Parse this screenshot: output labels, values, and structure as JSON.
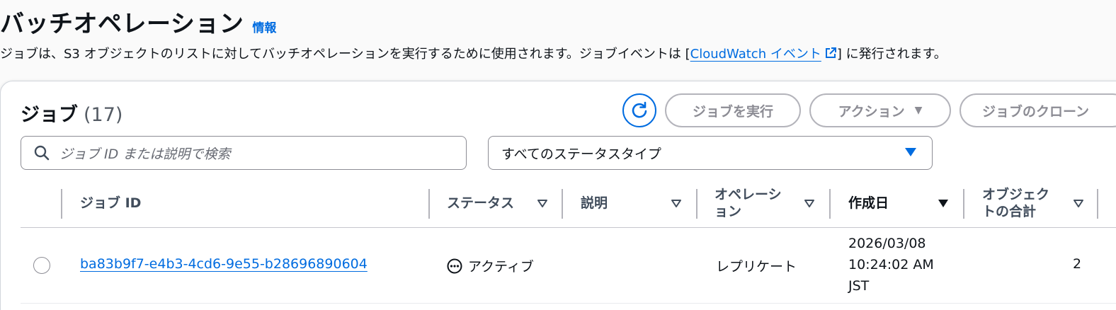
{
  "header": {
    "title": "バッチオペレーション",
    "info": "情報",
    "desc_before": "ジョブは、S3 オブジェクトのリストに対してバッチオペレーションを実行するために使用されます。ジョブイベントは [",
    "desc_link": "CloudWatch イベント",
    "desc_after": "] に発行されます。"
  },
  "jobs": {
    "title": "ジョブ",
    "count": "(17)",
    "run_label": "ジョブを実行",
    "actions_label": "アクション",
    "clone_label": "ジョブのクローン",
    "search_placeholder": "ジョブ ID または説明で検索",
    "status_filter": "すべてのステータスタイプ"
  },
  "table": {
    "columns": {
      "job_id": "ジョブ ID",
      "status": "ステータス",
      "description": "説明",
      "operation_1": "オペレーシ",
      "operation_2": "ョン",
      "created": "作成日",
      "objects_1": "オブジェク",
      "objects_2": "トの合計"
    },
    "rows": [
      {
        "job_id": "ba83b9f7-e4b3-4cd6-9e55-b28696890604",
        "status": "アクティブ",
        "description": "",
        "operation": "レプリケート",
        "created_date": "2026/03/08",
        "created_time": "10:24:02 AM",
        "created_tz": "JST",
        "objects": "2"
      }
    ]
  },
  "colors": {
    "accent": "#006ce0",
    "disabled": "#8c8c94",
    "text": "#0f141a"
  }
}
